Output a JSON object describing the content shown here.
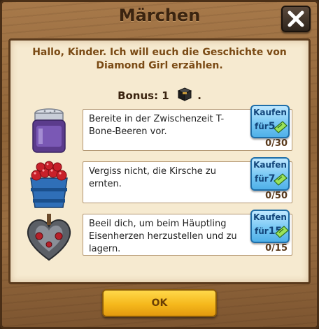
{
  "dialog": {
    "title": "Märchen",
    "intro": "Hallo, Kinder. Ich will euch die Geschichte von Diamond Girl erzählen.",
    "bonus_label": "Bonus: 1",
    "bonus_suffix": ".",
    "ok_label": "OK"
  },
  "tasks": [
    {
      "text": "Bereite in der Zwischenzeit T-Bone-Beeren vor.",
      "count": "0/30",
      "buy_label": "Kaufen",
      "buy_prefix": "für",
      "buy_price": "5",
      "icon": "jam-jar-icon"
    },
    {
      "text": "Vergiss nicht, die Kirsche zu ernten.",
      "count": "0/50",
      "buy_label": "Kaufen",
      "buy_prefix": "für",
      "buy_price": "7",
      "icon": "cherry-bucket-icon"
    },
    {
      "text": "Beeil dich, um beim Häuptling Eisenherzen herzustellen und zu lagern.",
      "count": "0/15",
      "buy_label": "Kaufen",
      "buy_prefix": "für",
      "buy_price": "15",
      "icon": "iron-heart-icon"
    }
  ],
  "colors": {
    "wood": "#9a6e41",
    "parchment": "#f6ead0",
    "buy_button": "#78c8f4",
    "ok_button": "#f5b81c",
    "intro_text": "#7a4a14"
  }
}
